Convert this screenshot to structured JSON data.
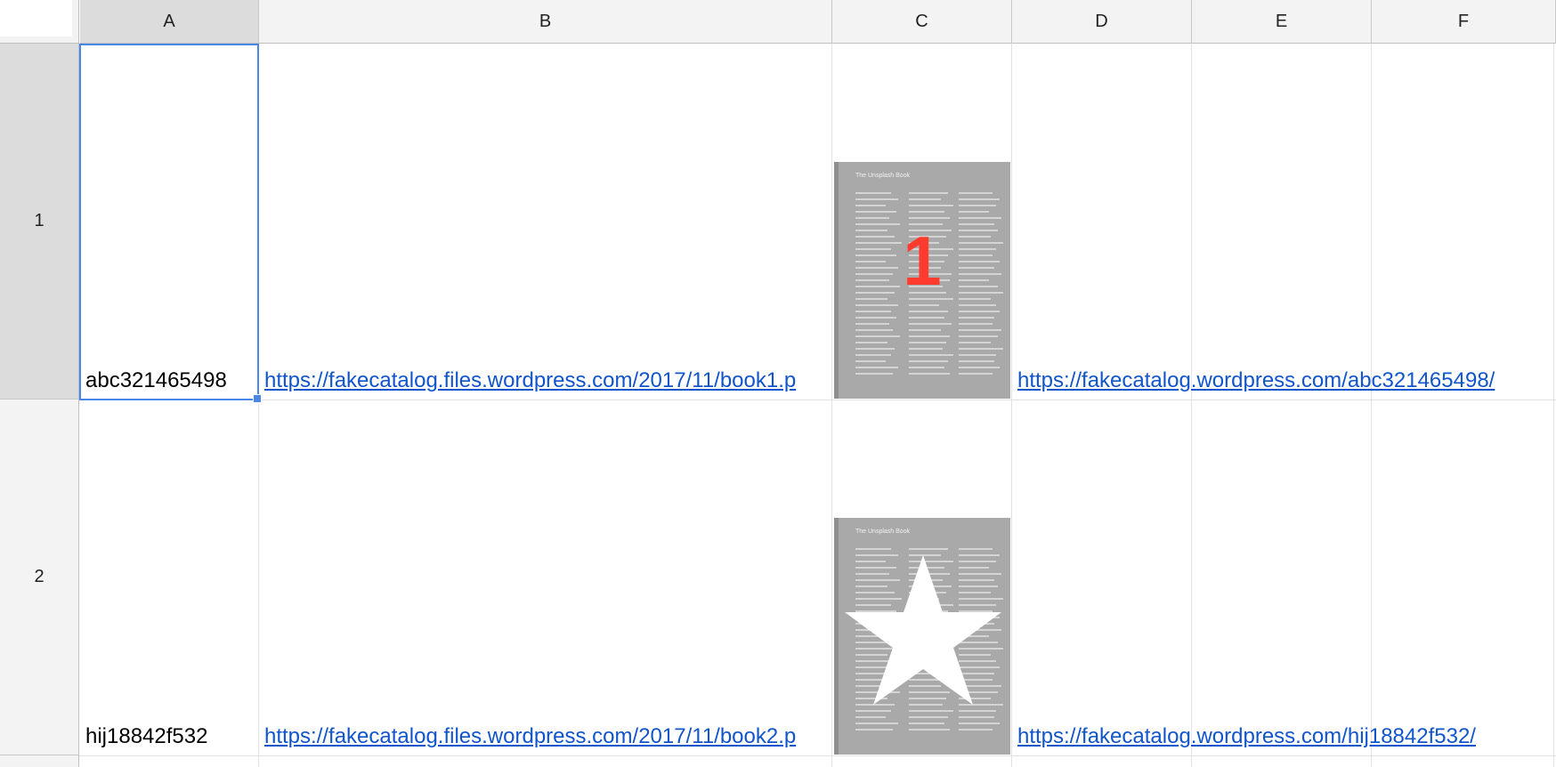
{
  "columns": [
    "A",
    "B",
    "C",
    "D",
    "E",
    "F"
  ],
  "rows": [
    {
      "number": "1",
      "id": "abc321465498",
      "image_url": "https://fakecatalog.files.wordpress.com/2017/11/book1.p",
      "link": "https://fakecatalog.wordpress.com/abc321465498/",
      "image": {
        "title": "The Unsplash Book",
        "overlay": "1",
        "overlay_color": "#ff3b30"
      }
    },
    {
      "number": "2",
      "id": "hij18842f532",
      "image_url": "https://fakecatalog.files.wordpress.com/2017/11/book2.p",
      "link": "https://fakecatalog.wordpress.com/hij18842f532/",
      "image": {
        "title": "The Unsplash Book",
        "overlay": "star-icon",
        "overlay_color": "#ffffff"
      }
    }
  ],
  "selection": {
    "cell": "A1",
    "color": "#4a86e8"
  },
  "link_color": "#1155cc"
}
